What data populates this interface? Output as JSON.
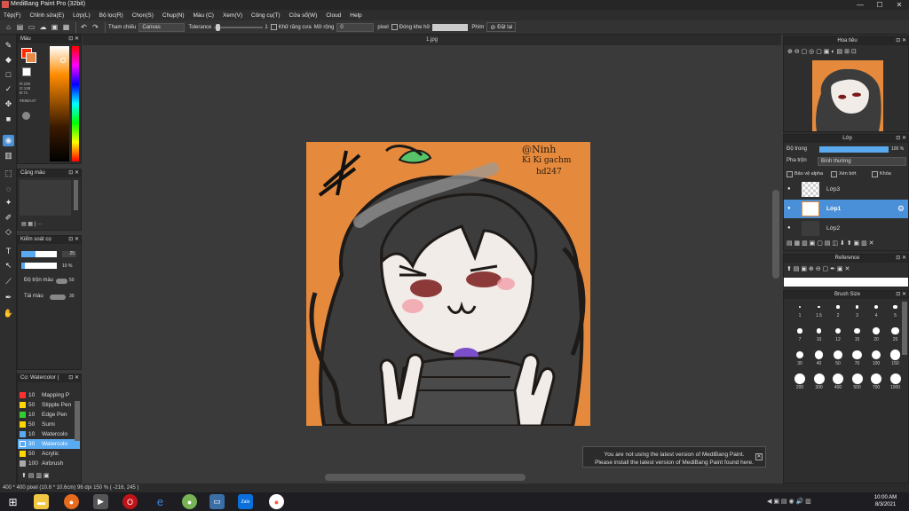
{
  "window": {
    "title": "MediBang Paint Pro (32bit)",
    "controls": [
      "—",
      "☐",
      "✕"
    ]
  },
  "menu": [
    "Tệp(F)",
    "Chỉnh sửa(E)",
    "Lớp(L)",
    "Bộ lọc(R)",
    "Chọn(S)",
    "Chụp(N)",
    "Màu (C)",
    "Xem(V)",
    "Công cụ(T)",
    "Cửa sổ(W)",
    "Cloud",
    "Help"
  ],
  "toolbar": {
    "tham_chieu_label": "Tham chiếu",
    "tham_chieu_value": "Canvas",
    "tolerance_label": "Tolerance",
    "tolerance_value": "1",
    "khu_rang_cua": "Khử răng cưa",
    "mo_rong_label": "Mở rộng",
    "mo_rong_value": "0",
    "pixel_label": "pixel",
    "dong_khe_ho": "Đóng khe hở",
    "phim_label": "Phím",
    "dat_lai": "Đặt lại"
  },
  "canvas": {
    "tab": "1.jpg"
  },
  "panels": {
    "color": {
      "title": "Màu",
      "values": "R:229\nG:138\nB:71",
      "hex": "#E58A47"
    },
    "color_set": {
      "title": "Cặng màu"
    },
    "brush_control": {
      "title": "Kiểm soát cọ",
      "size_value": "25",
      "opacity_value": "10 %",
      "mix_label": "Độ trộn màu",
      "mix_value": "50",
      "tai_mau_label": "Tái màu",
      "tai_mau_value": "30"
    },
    "brush_list": {
      "title": "Cọ: Watercolor (",
      "items": [
        {
          "num": "10",
          "name": "Mapping P",
          "color": "#ff3030"
        },
        {
          "num": "50",
          "name": "Stipple Pen",
          "color": "#ffd700"
        },
        {
          "num": "10",
          "name": "Edge Pen",
          "color": "#33cc33"
        },
        {
          "num": "50",
          "name": "Sumi",
          "color": "#ffd700"
        },
        {
          "num": "10",
          "name": "Watercolo",
          "color": "#5aaaf0"
        },
        {
          "num": "30",
          "name": "Watercolo",
          "color": "#5aaaf0"
        },
        {
          "num": "50",
          "name": "Acrylic",
          "color": "#ffd700"
        },
        {
          "num": "100",
          "name": "Airbrush",
          "color": "#aaaaaa"
        }
      ]
    },
    "navigator": {
      "title": "Hoa tiêu"
    },
    "layers": {
      "title": "Lớp",
      "opacity_label": "Độ trong",
      "opacity_value": "100 %",
      "blend_label": "Pha trộn",
      "blend_value": "Bình thường",
      "protect_alpha": "Bảo vệ alpha",
      "clip": "Xén bớt",
      "lock": "Khóa",
      "items": [
        "Lớp3",
        "Lớp1",
        "Lớp2"
      ]
    },
    "reference": {
      "title": "Reference"
    },
    "brush_size": {
      "title": "Brush Size",
      "labels": [
        "1",
        "1.5",
        "2",
        "3",
        "4",
        "5",
        "7",
        "10",
        "12",
        "15",
        "20",
        "25",
        "30",
        "40",
        "50",
        "70",
        "100",
        "150",
        "200",
        "300",
        "400",
        "500",
        "700",
        "1000"
      ]
    }
  },
  "artwork_text": {
    "line1": "@Ninh",
    "line2": "Ki Ki gachm",
    "line3": "hd247"
  },
  "notification": {
    "line1": "You are not using the latest version of MediBang Paint.",
    "line2": "Please install the latest version of MediBang Paint found here."
  },
  "status": {
    "text": "400 * 400 pixel  (10.6 * 10.6cm)  96 dpi  150 %  ( -216, 245 )"
  },
  "taskbar": {
    "time": "10:00 AM",
    "date": "8/3/2021",
    "zalo": "Zalo"
  }
}
